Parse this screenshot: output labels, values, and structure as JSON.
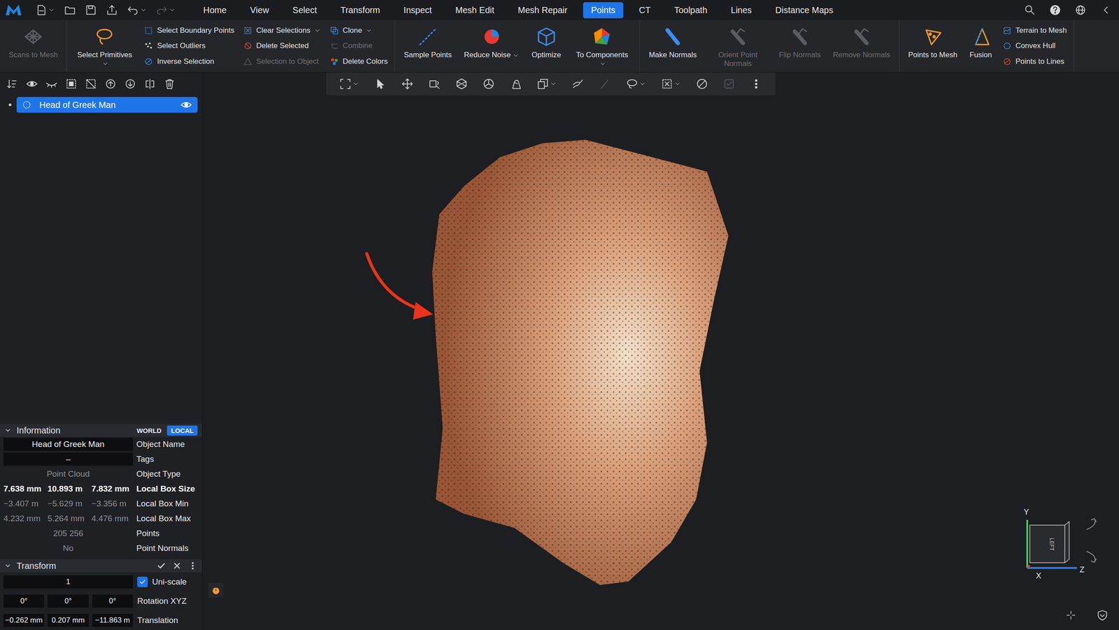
{
  "menubar": {
    "tabs": [
      {
        "label": "Home",
        "selected": false
      },
      {
        "label": "View",
        "selected": false
      },
      {
        "label": "Select",
        "selected": false
      },
      {
        "label": "Transform",
        "selected": false
      },
      {
        "label": "Inspect",
        "selected": false
      },
      {
        "label": "Mesh Edit",
        "selected": false
      },
      {
        "label": "Mesh Repair",
        "selected": false
      },
      {
        "label": "Points",
        "selected": true
      },
      {
        "label": "CT",
        "selected": false
      },
      {
        "label": "Toolpath",
        "selected": false
      },
      {
        "label": "Lines",
        "selected": false
      },
      {
        "label": "Distance Maps",
        "selected": false
      }
    ]
  },
  "ribbon": {
    "groups": [
      [
        {
          "kind": "big",
          "label": "Scans to Mesh",
          "disabled": true,
          "dropdown": false
        }
      ],
      [
        {
          "kind": "big",
          "label": "Select Primitives",
          "disabled": false,
          "dropdown": true
        },
        {
          "kind": "column",
          "items": [
            {
              "label": "Select Boundary Points",
              "disabled": false,
              "dropdown": false
            },
            {
              "label": "Select Outliers",
              "disabled": false,
              "dropdown": false
            },
            {
              "label": "Inverse Selection",
              "disabled": false,
              "dropdown": false
            }
          ]
        },
        {
          "kind": "column",
          "items": [
            {
              "label": "Clear Selections",
              "disabled": false,
              "dropdown": true
            },
            {
              "label": "Delete Selected",
              "disabled": false,
              "dropdown": false
            },
            {
              "label": "Selection to Object",
              "disabled": true,
              "dropdown": false
            }
          ]
        },
        {
          "kind": "column",
          "items": [
            {
              "label": "Clone",
              "disabled": false,
              "dropdown": true
            },
            {
              "label": "Combine",
              "disabled": true,
              "dropdown": false
            },
            {
              "label": "Delete Colors",
              "disabled": false,
              "dropdown": false
            }
          ]
        }
      ],
      [
        {
          "kind": "big",
          "label": "Sample Points",
          "disabled": false,
          "dropdown": false
        },
        {
          "kind": "big",
          "label": "Reduce Noise",
          "disabled": false,
          "dropdown": true
        },
        {
          "kind": "big",
          "label": "Optimize",
          "disabled": false,
          "dropdown": false
        },
        {
          "kind": "big",
          "label": "To Components",
          "disabled": false,
          "dropdown": true
        }
      ],
      [
        {
          "kind": "big",
          "label": "Make Normals",
          "disabled": false,
          "dropdown": false
        },
        {
          "kind": "big",
          "label": "Orient Point Normals",
          "disabled": true,
          "dropdown": false
        },
        {
          "kind": "big",
          "label": "Flip Normals",
          "disabled": true,
          "dropdown": false
        },
        {
          "kind": "big",
          "label": "Remove Normals",
          "disabled": true,
          "dropdown": false
        }
      ],
      [
        {
          "kind": "big",
          "label": "Points to Mesh",
          "disabled": false,
          "dropdown": false
        },
        {
          "kind": "big",
          "label": "Fusion",
          "disabled": false,
          "dropdown": false
        },
        {
          "kind": "column",
          "items": [
            {
              "label": "Terrain to Mesh",
              "disabled": false,
              "dropdown": false
            },
            {
              "label": "Convex Hull",
              "disabled": false,
              "dropdown": false
            },
            {
              "label": "Points to Lines",
              "disabled": false,
              "dropdown": false
            }
          ]
        }
      ]
    ]
  },
  "scene_tree": [
    {
      "label": "Head of Greek Man",
      "selected": true,
      "visible": true
    }
  ],
  "information": {
    "title": "Information",
    "frames": [
      {
        "label": "WORLD",
        "selected": false
      },
      {
        "label": "LOCAL",
        "selected": true
      }
    ],
    "rows": [
      {
        "kind": "field",
        "values": [
          "Head of Greek Man"
        ],
        "label": "Object Name"
      },
      {
        "kind": "field",
        "values": [
          "–"
        ],
        "label": "Tags"
      },
      {
        "kind": "muted",
        "values": [
          "Point Cloud"
        ],
        "label": "Object Type"
      },
      {
        "kind": "bold",
        "values": [
          "7.638 mm",
          "10.893 m",
          "7.832 mm"
        ],
        "label": "Local Box Size"
      },
      {
        "kind": "muted",
        "values": [
          "−3.407 m",
          "−5.629 m",
          "−3.356 m"
        ],
        "label": "Local Box Min"
      },
      {
        "kind": "muted",
        "values": [
          "4.232 mm",
          "5.264 mm",
          "4.476 mm"
        ],
        "label": "Local Box Max"
      },
      {
        "kind": "muted",
        "values": [
          "205 256"
        ],
        "label": "Points"
      },
      {
        "kind": "muted",
        "values": [
          "No"
        ],
        "label": "Point Normals"
      }
    ]
  },
  "transform": {
    "title": "Transform",
    "rows": [
      {
        "kind": "scale",
        "values": [
          "1"
        ],
        "label": "Uni-scale",
        "checked": true
      },
      {
        "kind": "fields",
        "values": [
          "0°",
          "0°",
          "0°"
        ],
        "label": "Rotation XYZ"
      },
      {
        "kind": "fields",
        "values": [
          "−0.262 mm",
          "0.207 mm",
          "−11.863 m"
        ],
        "label": "Translation"
      }
    ]
  },
  "viewport_toolbar": [
    {
      "dropdown": true,
      "disabled": false
    },
    {
      "dropdown": false,
      "disabled": false
    },
    {
      "dropdown": false,
      "disabled": false
    },
    {
      "dropdown": false,
      "disabled": false
    },
    {
      "dropdown": false,
      "disabled": false
    },
    {
      "dropdown": false,
      "disabled": false
    },
    {
      "dropdown": false,
      "disabled": false
    },
    {
      "dropdown": true,
      "disabled": false
    },
    {
      "dropdown": false,
      "disabled": false
    },
    {
      "dropdown": false,
      "disabled": true
    },
    {
      "dropdown": true,
      "disabled": false
    },
    {
      "dropdown": true,
      "disabled": false
    },
    {
      "dropdown": false,
      "disabled": false
    },
    {
      "dropdown": false,
      "disabled": true
    },
    {
      "dropdown": false,
      "disabled": false
    }
  ],
  "gizmo": {
    "y": "Y",
    "z": "Z",
    "x": "X",
    "face": "LEFT"
  }
}
